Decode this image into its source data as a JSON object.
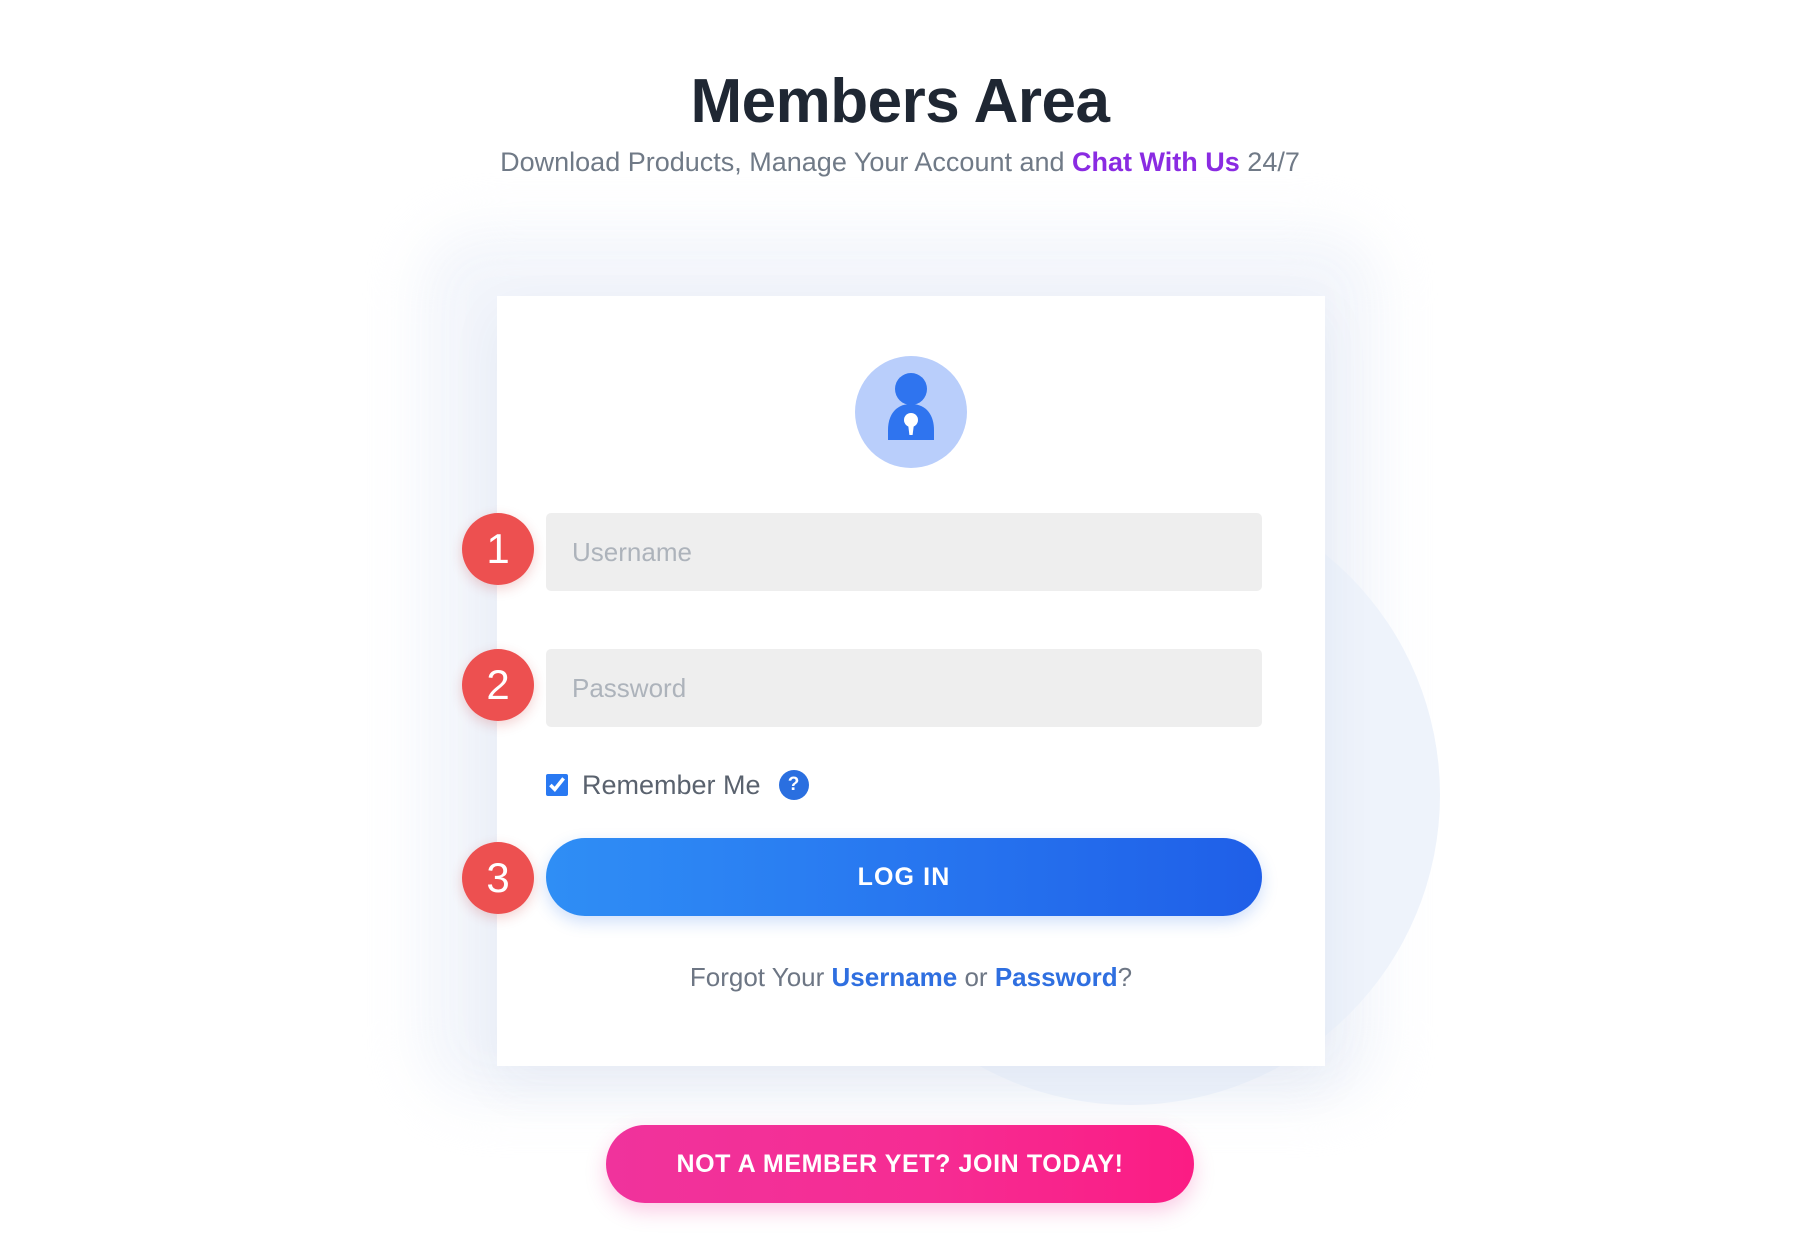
{
  "header": {
    "title": "Members Area",
    "subtitle_before": "Download Products, Manage Your Account and ",
    "subtitle_link": "Chat With Us",
    "subtitle_after": " 24/7"
  },
  "login_card": {
    "avatar_icon": "user-lock-avatar-icon",
    "steps": {
      "badge_1": "1",
      "badge_2": "2",
      "badge_3": "3"
    },
    "username": {
      "placeholder": "Username",
      "value": ""
    },
    "password": {
      "placeholder": "Password",
      "value": ""
    },
    "remember": {
      "label": "Remember Me",
      "checked": true,
      "help_icon": "?"
    },
    "login_button_label": "LOG IN",
    "forgot": {
      "prefix": "Forgot Your ",
      "username_link": "Username",
      "separator": " or ",
      "password_link": "Password",
      "suffix": "?"
    }
  },
  "join_button_label": "NOT A MEMBER YET? JOIN TODAY!",
  "colors": {
    "title": "#1f2733",
    "subtitle_text": "#707a87",
    "chat_link": "#8A2BE2",
    "badge": "#ed5050",
    "login_gradient_start": "#2f8ef5",
    "login_gradient_end": "#1f5fe8",
    "join_gradient_start": "#f0339c",
    "join_gradient_end": "#fb1c84",
    "forgot_link": "#2f6fe0",
    "help_icon": "#2a6fe0",
    "field_background": "#eeeeee",
    "placeholder": "#adb3bb",
    "avatar_ring": "#b9cefb",
    "avatar_figure": "#2f74ef",
    "deco_circle": "#eef3fb"
  }
}
